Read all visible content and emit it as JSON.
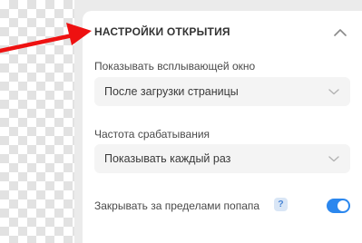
{
  "settings": {
    "section_title": "НАСТРОЙКИ ОТКРЫТИЯ",
    "show_popup": {
      "label": "Показывать всплывающей окно",
      "value": "После загрузки страницы"
    },
    "frequency": {
      "label": "Частота срабатывания",
      "value": "Показывать каждый раз"
    },
    "close_outside": {
      "label": "Закрывать за пределами попапа",
      "help_symbol": "?",
      "enabled": true
    }
  },
  "colors": {
    "accent": "#2b87ee",
    "annotation_arrow": "#ee1111",
    "panel_background": "#ffffff",
    "field_background": "#f4f4f4"
  },
  "icons": {
    "section_toggle": "chevron-up-icon",
    "dropdown": "chevron-down-icon",
    "help": "question-icon"
  }
}
